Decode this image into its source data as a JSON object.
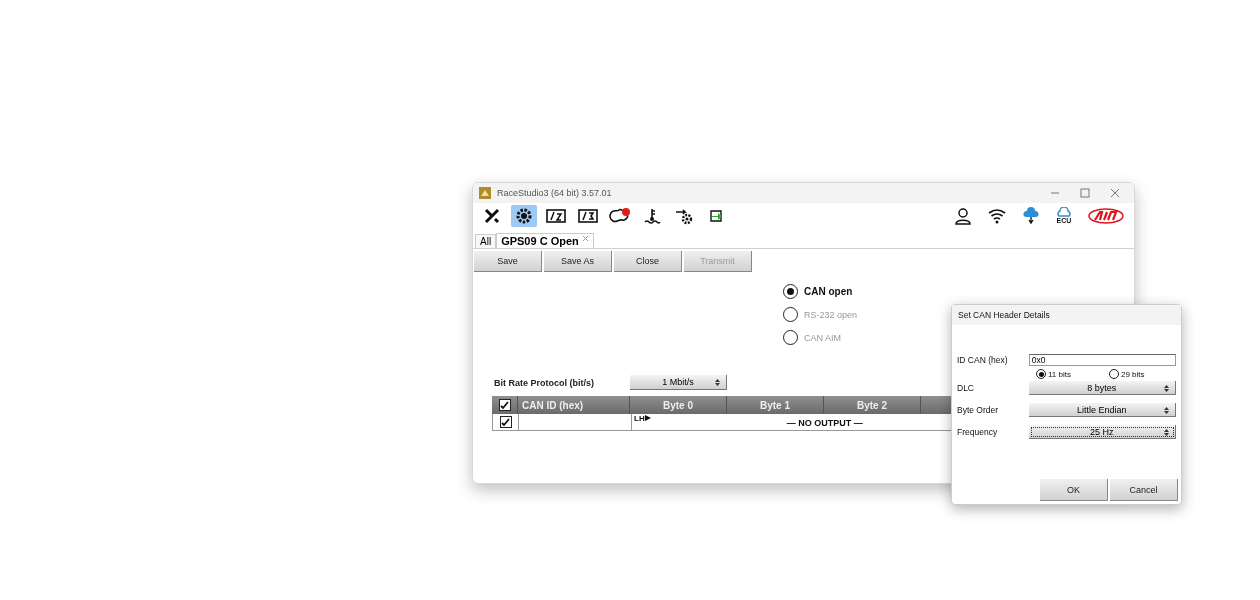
{
  "window": {
    "title": "RaceStudio3 (64 bit) 3.57.01"
  },
  "toolbar": {
    "items": [
      {
        "kind": "wrench",
        "selected": false
      },
      {
        "kind": "gear",
        "selected": true
      },
      {
        "kind": "gauge2",
        "selected": false
      },
      {
        "kind": "gauge3",
        "selected": false
      },
      {
        "kind": "track",
        "selected": false,
        "badge": true
      },
      {
        "kind": "thermo",
        "selected": false
      },
      {
        "kind": "gearplus",
        "selected": false
      },
      {
        "kind": "sync",
        "selected": false
      }
    ],
    "right": [
      {
        "kind": "user"
      },
      {
        "kind": "wifi"
      },
      {
        "kind": "cloud"
      },
      {
        "kind": "ecu",
        "label": "ECU"
      },
      {
        "kind": "logo"
      }
    ]
  },
  "tabs": [
    {
      "label": "All",
      "selected": false,
      "closable": false
    },
    {
      "label": "GPS09 C Open",
      "selected": true,
      "closable": true
    }
  ],
  "buttons": [
    {
      "label": "Save",
      "disabled": false
    },
    {
      "label": "Save As",
      "disabled": false
    },
    {
      "label": "Close",
      "disabled": false
    },
    {
      "label": "Transmit",
      "disabled": true
    }
  ],
  "protocols": [
    {
      "label": "CAN open",
      "selected": true,
      "disabled": false
    },
    {
      "label": "RS-232 open",
      "selected": false,
      "disabled": true
    },
    {
      "label": "CAN AIM",
      "selected": false,
      "disabled": true
    }
  ],
  "bit_rate": {
    "label": "Bit Rate Protocol (bit/s)",
    "value": "1 Mbit/s"
  },
  "table": {
    "header_checked": true,
    "columns": [
      "CAN ID (hex)",
      "Byte 0",
      "Byte 1",
      "Byte 2"
    ],
    "rows": [
      {
        "checked": true,
        "byte_order": "LH",
        "output": "— NO OUTPUT —"
      }
    ]
  },
  "dialog": {
    "title": "Set CAN Header Details",
    "id_label": "ID CAN (hex)",
    "id_value": "0x0",
    "bits": [
      {
        "label": "11 bits",
        "selected": true
      },
      {
        "label": "29 bits",
        "selected": false
      }
    ],
    "selects": [
      {
        "label": "DLC",
        "value": "8 bytes",
        "focused": false
      },
      {
        "label": "Byte Order",
        "value": "Little Endian",
        "focused": false
      },
      {
        "label": "Frequency",
        "value": "25 Hz",
        "focused": true
      }
    ],
    "buttons": [
      "OK",
      "Cancel"
    ]
  }
}
